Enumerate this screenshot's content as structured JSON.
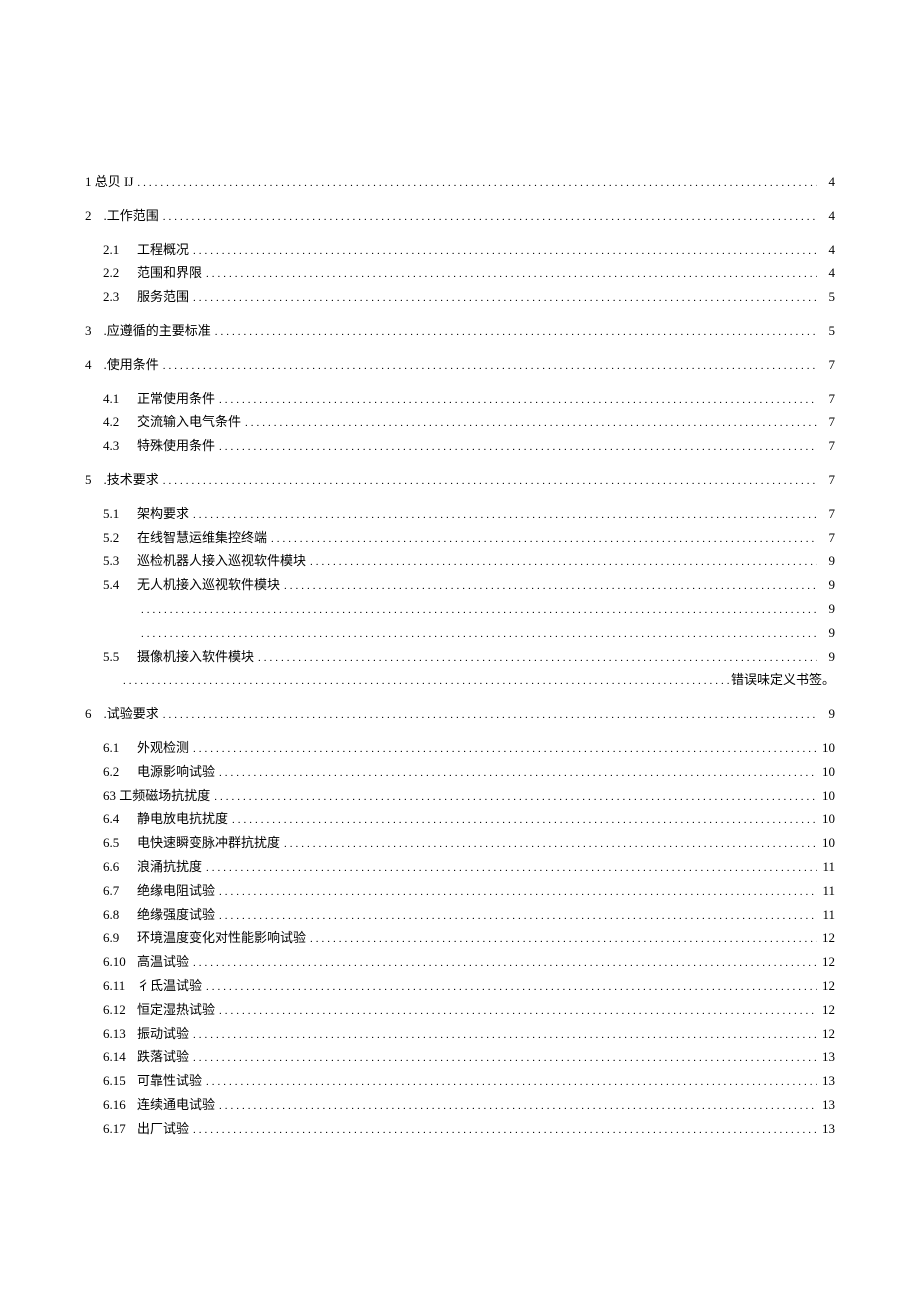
{
  "toc": [
    {
      "level": 1,
      "num": "1",
      "label": "总贝 IJ",
      "page": "4",
      "noSep": true
    },
    {
      "level": 1,
      "num": "2",
      "label": ".工作范围",
      "page": "4"
    },
    {
      "level": 2,
      "num": "2.1",
      "label": "工程概况",
      "page": "4"
    },
    {
      "level": 2,
      "num": "2.2",
      "label": "范围和界限",
      "page": "4"
    },
    {
      "level": 2,
      "num": "2.3",
      "label": "服务范围",
      "page": "5"
    },
    {
      "level": 1,
      "num": "3",
      "label": ".应遵循的主要标准",
      "page": "5"
    },
    {
      "level": 1,
      "num": "4",
      "label": ".使用条件",
      "page": "7"
    },
    {
      "level": 2,
      "num": "4.1",
      "label": "正常使用条件",
      "page": "7"
    },
    {
      "level": 2,
      "num": "4.2",
      "label": "交流输入电气条件",
      "page": "7"
    },
    {
      "level": 2,
      "num": "4.3",
      "label": "特殊使用条件",
      "page": "7"
    },
    {
      "level": 1,
      "num": "5",
      "label": ".技术要求",
      "page": "7"
    },
    {
      "level": 2,
      "num": "5.1",
      "label": "架构要求",
      "page": "7"
    },
    {
      "level": 2,
      "num": "5.2",
      "label": "在线智慧运维集控终端",
      "page": "7"
    },
    {
      "level": 2,
      "num": "5.3",
      "label": "巡检机器人接入巡视软件模块",
      "page": "9"
    },
    {
      "level": 2,
      "num": "5.4",
      "label": "无人机接入巡视软件模块",
      "page": "9"
    },
    {
      "level": 2,
      "num": "",
      "label": "",
      "page": "9",
      "blank": true
    },
    {
      "level": 2,
      "num": "",
      "label": "",
      "page": "9",
      "blank": true
    },
    {
      "level": 2,
      "num": "5.5",
      "label": "摄像机接入软件模块",
      "page": "9"
    },
    {
      "level": 2,
      "num": "",
      "label": "",
      "page": "错误味定义书签。",
      "blank": true,
      "errLine": true
    },
    {
      "level": 1,
      "num": "6",
      "label": ".试验要求",
      "page": "9"
    },
    {
      "level": 2,
      "num": "6.1",
      "label": "外观检测",
      "page": "10"
    },
    {
      "level": 2,
      "num": "6.2",
      "label": "电源影响试验",
      "page": "10"
    },
    {
      "level": 2,
      "num": "63",
      "label": "工频磁场抗扰度",
      "page": "10",
      "joined": true
    },
    {
      "level": 2,
      "num": "6.4",
      "label": "静电放电抗扰度",
      "page": "10"
    },
    {
      "level": 2,
      "num": "6.5",
      "label": "电快速瞬变脉冲群抗扰度",
      "page": "10"
    },
    {
      "level": 2,
      "num": "6.6",
      "label": "浪涌抗扰度",
      "page": "11"
    },
    {
      "level": 2,
      "num": "6.7",
      "label": "绝缘电阻试验",
      "page": "11"
    },
    {
      "level": 2,
      "num": "6.8",
      "label": "绝缘强度试验",
      "page": "11"
    },
    {
      "level": 2,
      "num": "6.9",
      "label": "环境温度变化对性能影响试验",
      "page": "12"
    },
    {
      "level": 2,
      "num": "6.10",
      "label": "高温试验",
      "page": "12"
    },
    {
      "level": 2,
      "num": "6.11",
      "label": "彳氐温试验",
      "page": "12"
    },
    {
      "level": 2,
      "num": "6.12",
      "label": "恒定湿热试验",
      "page": "12"
    },
    {
      "level": 2,
      "num": "6.13",
      "label": "振动试验",
      "page": "12"
    },
    {
      "level": 2,
      "num": "6.14",
      "label": "跌落试验",
      "page": "13"
    },
    {
      "level": 2,
      "num": "6.15",
      "label": "可靠性试验",
      "page": "13"
    },
    {
      "level": 2,
      "num": "6.16",
      "label": "连续通电试验",
      "page": "13"
    },
    {
      "level": 2,
      "num": "6.17",
      "label": "出厂试验",
      "page": "13"
    }
  ]
}
